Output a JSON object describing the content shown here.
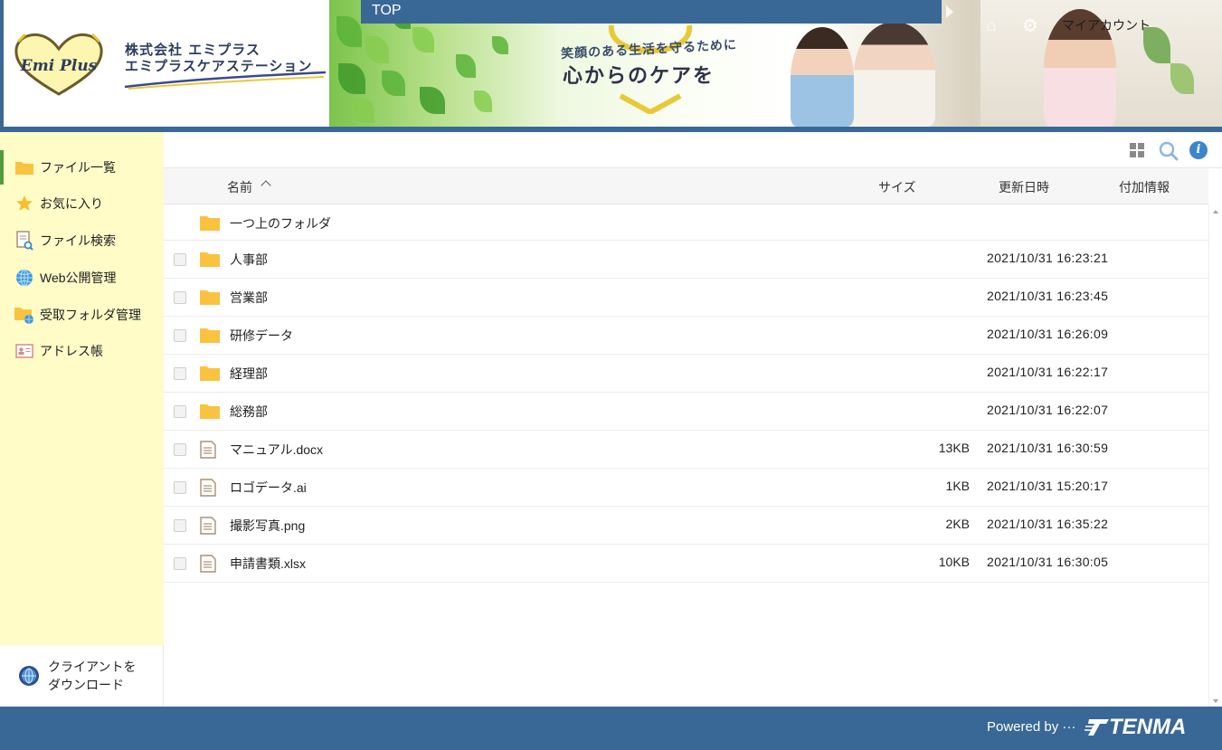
{
  "header": {
    "logo_text": "Emi Plus",
    "company_line1": "株式会社 エミプラス",
    "company_line2": "エミプラスケアステーション",
    "banner_subtitle": "笑顔のある生活を守るために",
    "banner_title": "心からのケアを",
    "breadcrumb": "TOP",
    "account_label": "マイアカウント",
    "colors": {
      "primary": "#3a6896",
      "sidebar_bg": "#fffcc8",
      "folder": "#f9c33f"
    }
  },
  "sidebar": {
    "items": [
      {
        "label": "ファイル一覧",
        "icon": "folder-icon"
      },
      {
        "label": "お気に入り",
        "icon": "star-icon"
      },
      {
        "label": "ファイル検索",
        "icon": "file-search-icon"
      },
      {
        "label": "Web公開管理",
        "icon": "globe-icon"
      },
      {
        "label": "受取フォルダ管理",
        "icon": "folder-globe-icon"
      },
      {
        "label": "アドレス帳",
        "icon": "address-book-icon"
      }
    ],
    "download_line1": "クライアントを",
    "download_line2": "ダウンロード"
  },
  "toolbar": {
    "icons": [
      "grid-view-icon",
      "search-icon",
      "info-icon"
    ],
    "info_glyph": "i"
  },
  "table": {
    "columns": {
      "name": "名前",
      "size": "サイズ",
      "updated": "更新日時",
      "extra": "付加情報"
    },
    "parent_folder": "一つ上のフォルダ",
    "rows": [
      {
        "name": "人事部",
        "type": "folder",
        "size": "",
        "updated": "2021/10/31 16:23:21"
      },
      {
        "name": "営業部",
        "type": "folder",
        "size": "",
        "updated": "2021/10/31 16:23:45"
      },
      {
        "name": "研修データ",
        "type": "folder",
        "size": "",
        "updated": "2021/10/31 16:26:09"
      },
      {
        "name": "経理部",
        "type": "folder",
        "size": "",
        "updated": "2021/10/31 16:22:17"
      },
      {
        "name": "総務部",
        "type": "folder",
        "size": "",
        "updated": "2021/10/31 16:22:07"
      },
      {
        "name": "マニュアル.docx",
        "type": "file",
        "size": "13KB",
        "updated": "2021/10/31 16:30:59"
      },
      {
        "name": "ロゴデータ.ai",
        "type": "file",
        "size": "1KB",
        "updated": "2021/10/31 15:20:17"
      },
      {
        "name": "撮影写真.png",
        "type": "file",
        "size": "2KB",
        "updated": "2021/10/31 16:35:22"
      },
      {
        "name": "申請書類.xlsx",
        "type": "file",
        "size": "10KB",
        "updated": "2021/10/31 16:30:05"
      }
    ]
  },
  "footer": {
    "powered_by": "Powered by ···",
    "brand": "TENMA"
  }
}
